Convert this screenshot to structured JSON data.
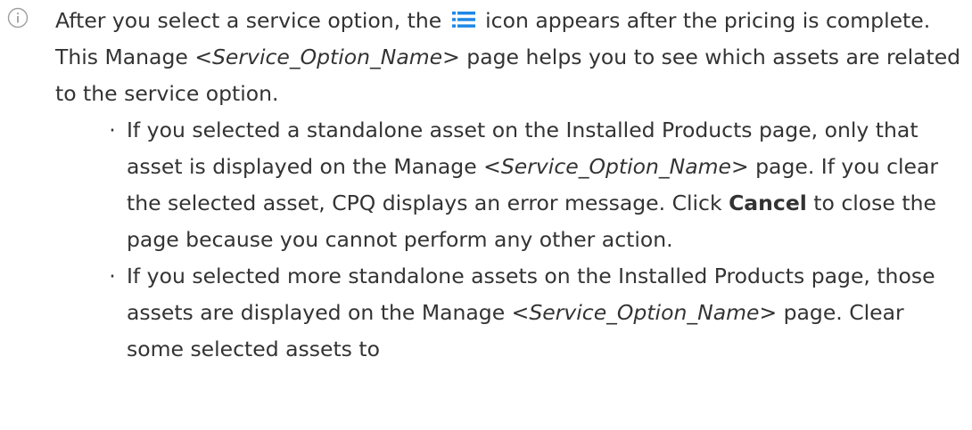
{
  "icons": {
    "info": "info-circle-icon",
    "list": "list-icon",
    "list_color": "#1e88e5",
    "info_color": "#9e9e9e"
  },
  "note": {
    "part1": "After you select a service option, the ",
    "part2": " icon appears after the pricing is complete. This Manage ",
    "part3_em": "<Service_Option_Name>",
    "part4": " page helps you to see which assets are related to the service option."
  },
  "bullets": [
    {
      "dot": "·",
      "part1": "If you selected a standalone asset on the Installed Products page, only that asset is displayed on the Manage ",
      "part2_em": "<Service_Option_Name>",
      "part3": " page. If you clear the selected asset, CPQ displays an error message. Click ",
      "part4_strong": "Cancel",
      "part5": " to close the page because you cannot perform any other action."
    },
    {
      "dot": "·",
      "part1": "If you selected more standalone assets on the Installed Products page, those assets are displayed on the Manage ",
      "part2_em": "<Service_Option_Name>",
      "part3": " page. Clear some selected assets to"
    }
  ]
}
